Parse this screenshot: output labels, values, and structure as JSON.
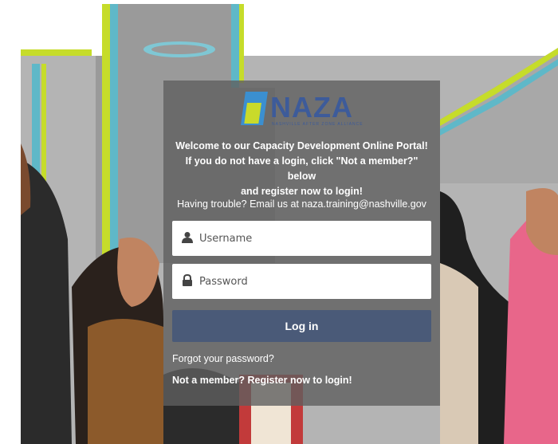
{
  "brand": {
    "logo_text": "NAZA",
    "tagline": "NASHVILLE AFTER ZONE ALLIANCE",
    "colors": {
      "blue": "#3d5b9a",
      "lime": "#c9da2b"
    }
  },
  "login": {
    "welcome_line1": "Welcome to our Capacity Development Online Portal!",
    "welcome_line2": "If you do not have a login, click \"Not a member?\" below",
    "welcome_line3": "and register now to login!",
    "trouble_text": "Having trouble? Email us at naza.training@nashville.gov",
    "username_placeholder": "Username",
    "password_placeholder": "Password",
    "login_button": "Log in",
    "forgot_password": "Forgot your password?",
    "register_link": "Not a member? Register now to login!"
  },
  "icons": {
    "username": "user-icon",
    "password": "lock-icon"
  },
  "colors": {
    "button": "#4a5a78",
    "panel": "#5f5f5f"
  }
}
